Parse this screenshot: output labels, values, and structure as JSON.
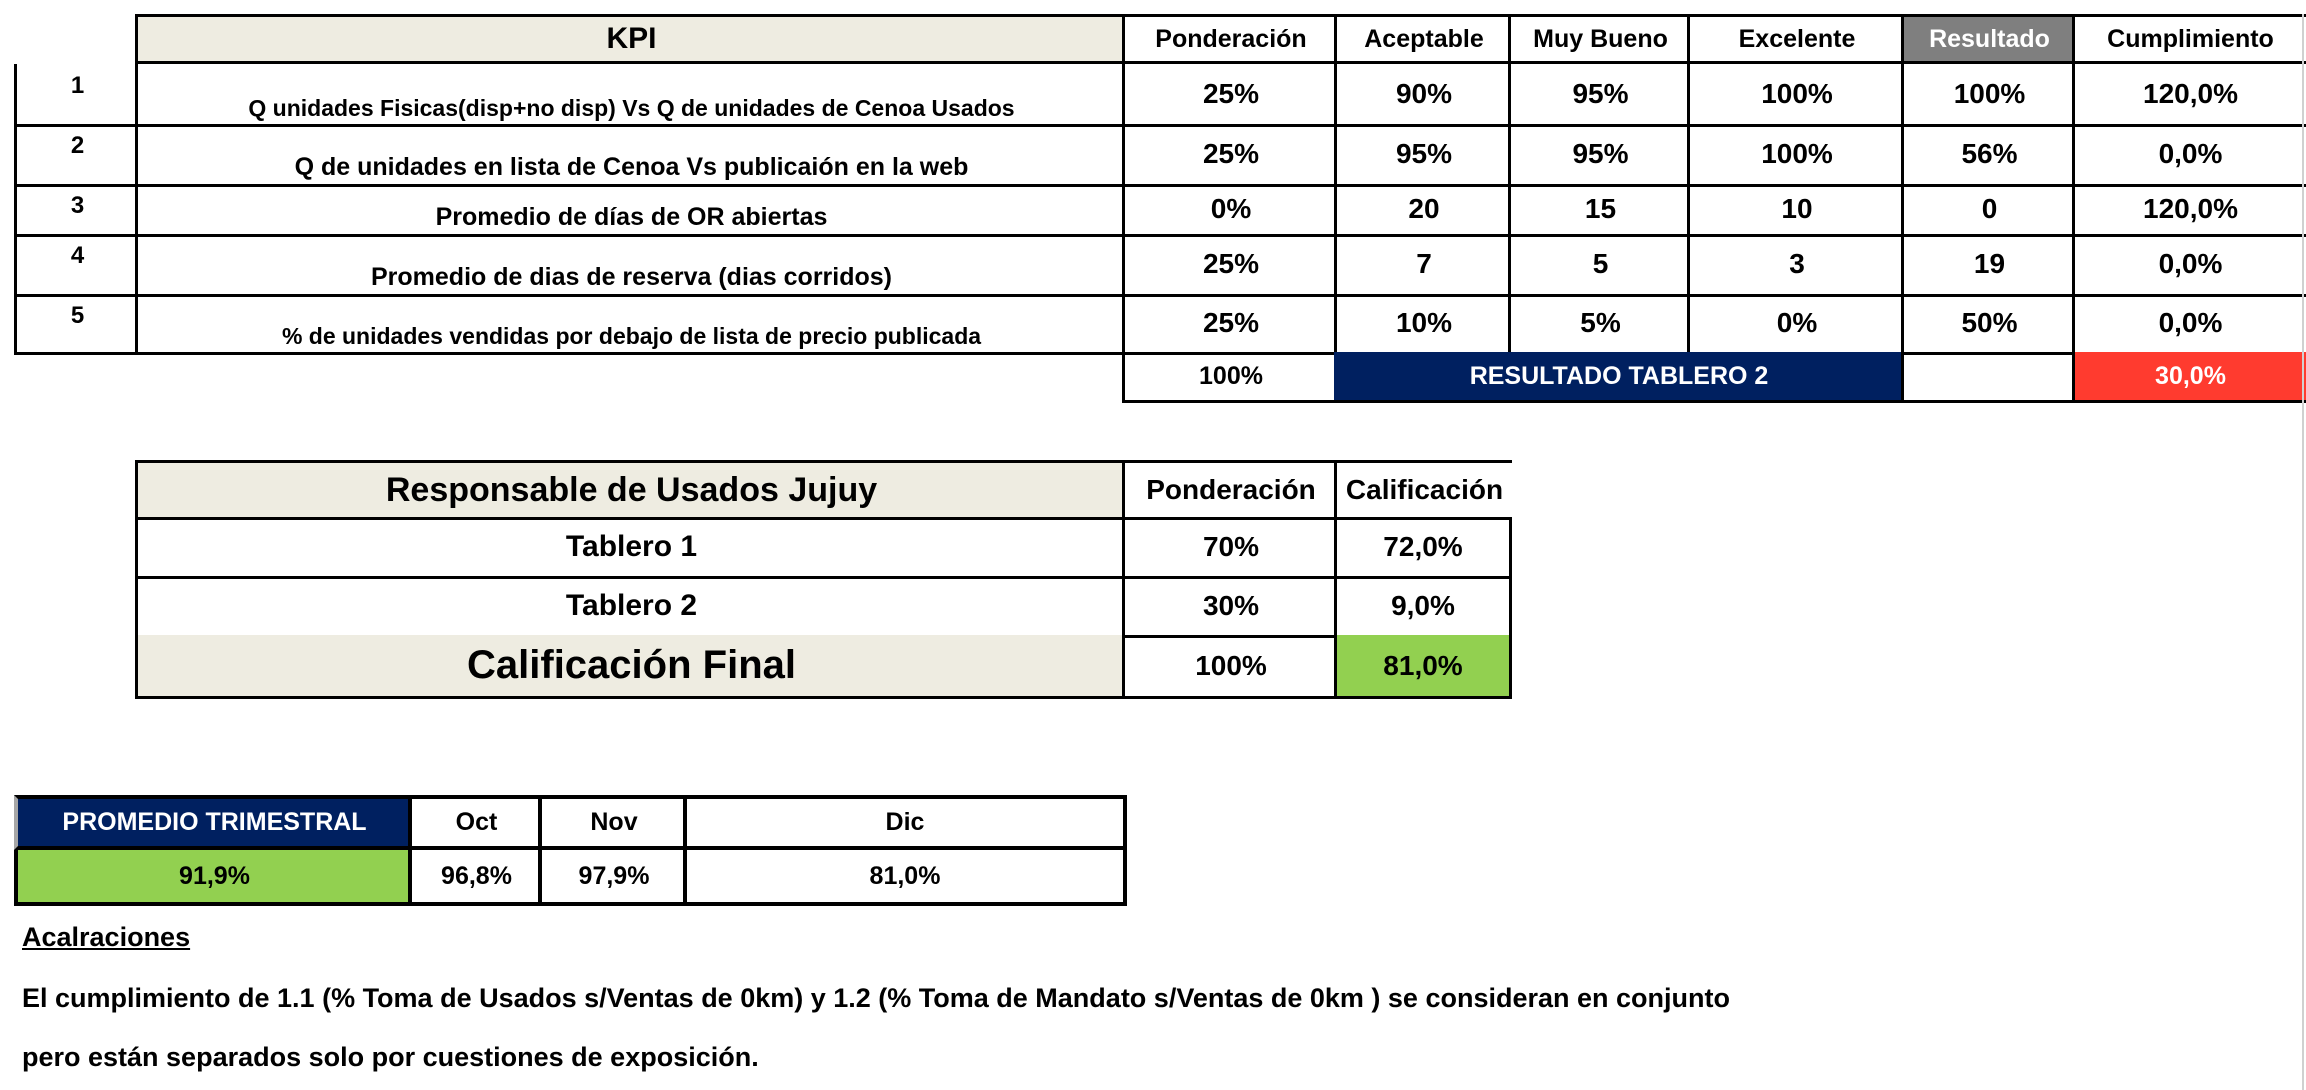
{
  "kpi_table": {
    "headers": {
      "kpi": "KPI",
      "ponderacion": "Ponderación",
      "aceptable": "Aceptable",
      "muy_bueno": "Muy Bueno",
      "excelente": "Excelente",
      "resultado": "Resultado",
      "cumplimiento": "Cumplimiento"
    },
    "rows": [
      {
        "num": "1",
        "kpi": "Q unidades Fisicas(disp+no disp) Vs Q de unidades de Cenoa Usados",
        "ponderacion": "25%",
        "aceptable": "90%",
        "muy_bueno": "95%",
        "excelente": "100%",
        "resultado": "100%",
        "cumplimiento": "120,0%"
      },
      {
        "num": "2",
        "kpi": "Q de unidades en lista de Cenoa Vs publicaión en la web",
        "ponderacion": "25%",
        "aceptable": "95%",
        "muy_bueno": "95%",
        "excelente": "100%",
        "resultado": "56%",
        "cumplimiento": "0,0%"
      },
      {
        "num": "3",
        "kpi": "Promedio de días de OR abiertas",
        "ponderacion": "0%",
        "aceptable": "20",
        "muy_bueno": "15",
        "excelente": "10",
        "resultado": "0",
        "cumplimiento": "120,0%"
      },
      {
        "num": "4",
        "kpi": "Promedio de dias de reserva (dias corridos)",
        "ponderacion": "25%",
        "aceptable": "7",
        "muy_bueno": "5",
        "excelente": "3",
        "resultado": "19",
        "cumplimiento": "0,0%"
      },
      {
        "num": "5",
        "kpi": "% de unidades vendidas por debajo de lista de precio publicada",
        "ponderacion": "25%",
        "aceptable": "10%",
        "muy_bueno": "5%",
        "excelente": "0%",
        "resultado": "50%",
        "cumplimiento": "0,0%"
      }
    ],
    "total": {
      "ponderacion": "100%",
      "label": "RESULTADO TABLERO 2",
      "cumplimiento": "30,0%"
    }
  },
  "summary_table": {
    "title": "Responsable de Usados Jujuy",
    "col_ponderacion": "Ponderación",
    "col_calificacion": "Calificación",
    "rows": [
      {
        "label": "Tablero 1",
        "ponderacion": "70%",
        "calificacion": "72,0%"
      },
      {
        "label": "Tablero 2",
        "ponderacion": "30%",
        "calificacion": "9,0%"
      }
    ],
    "final": {
      "label": "Calificación Final",
      "ponderacion": "100%",
      "calificacion": "81,0%"
    }
  },
  "quarterly": {
    "label": "PROMEDIO TRIMESTRAL",
    "value": "91,9%",
    "months": [
      {
        "name": "Oct",
        "value": "96,8%"
      },
      {
        "name": "Nov",
        "value": "97,9%"
      },
      {
        "name": "Dic",
        "value": "81,0%"
      }
    ]
  },
  "notes": {
    "heading": "Acalraciones",
    "line1": "El cumplimiento de 1.1 (% Toma de Usados s/Ventas de 0km) y 1.2 (% Toma de Mandato s/Ventas de 0km ) se consideran en conjunto",
    "line2": "pero están separados  solo por cuestiones de exposición."
  },
  "colors": {
    "header_beige": "#eeece1",
    "resultado_header": "#7f7f7f",
    "navy": "#002060",
    "red": "#ff3b2f",
    "green": "#92d050"
  }
}
